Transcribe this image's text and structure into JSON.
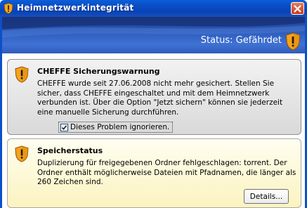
{
  "window": {
    "title": "Heimnetzwerkintegrität",
    "title_icon": "shield-warning-icon",
    "close_icon": "close-icon"
  },
  "header": {
    "status_label": "Status: Gefährdet",
    "status_icon": "shield-warning-icon"
  },
  "warning_panel": {
    "icon": "shield-warning-icon",
    "title": "CHEFFE Sicherungswarnung",
    "body": "CHEFFE wurde seit 27.06.2008 nicht mehr gesichert. Stellen Sie sicher, dass CHEFFE eingeschaltet und mit dem Heimnetzwerk verbunden ist. Über die Option \"Jetzt sichern\" können sie jederzeit eine manuelle Sicherung durchführen.",
    "ignore_checkbox_label": "Dieses Problem ignorieren.",
    "ignore_checked": true
  },
  "storage_panel": {
    "icon": "shield-warning-icon",
    "title": "Speicherstatus",
    "body": "Duplizierung für freigegebenen Ordner fehlgeschlagen: torrent. Der Ordner enthält möglicherweise Dateien mit Pfadnamen, die länger als 260 Zeichen sind.",
    "details_button": "Details..."
  },
  "colors": {
    "titlebar": "#0a5fd8",
    "header": "#2f5ebf",
    "warning_panel_bg": "#e0e0e0",
    "storage_panel_bg": "#fbf3c0",
    "shield_orange": "#f0a020"
  }
}
